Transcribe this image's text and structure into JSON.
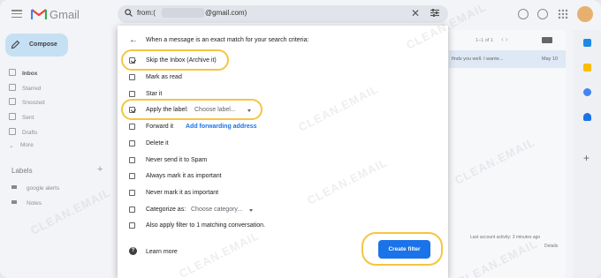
{
  "app": {
    "title": "Gmail"
  },
  "search": {
    "prefix": "from:(",
    "suffix": "@gmail.com)"
  },
  "sidebar": {
    "compose_label": "Compose",
    "items": [
      {
        "label": "Inbox",
        "bold": true
      },
      {
        "label": "Starred"
      },
      {
        "label": "Snoozed"
      },
      {
        "label": "Sent"
      },
      {
        "label": "Drafts"
      },
      {
        "label": "More"
      }
    ],
    "labels_heading": "Labels",
    "labels": [
      {
        "label": "google alerts"
      },
      {
        "label": "Notes"
      }
    ]
  },
  "mail": {
    "pager": "1–1 of 1",
    "row_snippet": "finds you well. I wante...",
    "row_date": "May 10",
    "activity": "Last account activity: 3 minutes ago",
    "details": "Details"
  },
  "dialog": {
    "title": "When a message is an exact match for your search criteria:",
    "options": [
      {
        "label": "Skip the Inbox (Archive it)",
        "checked": true
      },
      {
        "label": "Mark as read",
        "checked": false
      },
      {
        "label": "Star it",
        "checked": false
      },
      {
        "label": "Apply the label:",
        "checked": true
      },
      {
        "label": "Forward it",
        "checked": false
      },
      {
        "label": "Delete it",
        "checked": false
      },
      {
        "label": "Never send it to Spam",
        "checked": false
      },
      {
        "label": "Always mark it as important",
        "checked": false
      },
      {
        "label": "Never mark it as important",
        "checked": false
      },
      {
        "label": "Categorize as:",
        "checked": false
      },
      {
        "label": "Also apply filter to 1 matching conversation.",
        "checked": false
      }
    ],
    "apply_label_dropdown": "Choose label...",
    "add_forwarding_link": "Add forwarding address",
    "categorize_dropdown": "Choose category...",
    "learn_more": "Learn more",
    "create_filter": "Create filter"
  },
  "watermark": "CLEAN.EMAIL",
  "colors": {
    "accent": "#1a73e8",
    "highlight": "#f5c542"
  }
}
